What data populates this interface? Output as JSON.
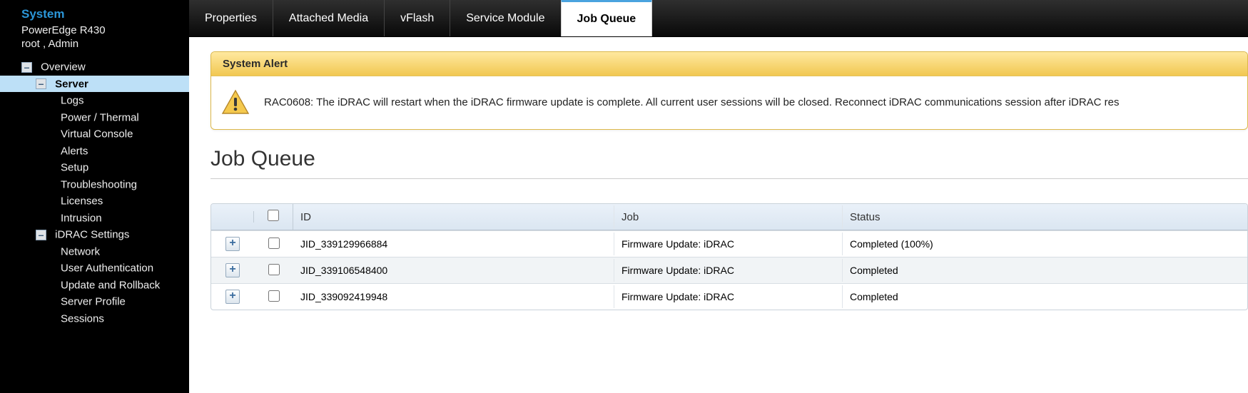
{
  "sidebar": {
    "system_label": "System",
    "model": "PowerEdge R430",
    "user": "root , Admin",
    "tree": {
      "overview": "Overview",
      "server": "Server",
      "server_children": [
        "Logs",
        "Power / Thermal",
        "Virtual Console",
        "Alerts",
        "Setup",
        "Troubleshooting",
        "Licenses",
        "Intrusion"
      ],
      "idrac": "iDRAC Settings",
      "idrac_children": [
        "Network",
        "User Authentication",
        "Update and Rollback",
        "Server Profile",
        "Sessions"
      ]
    }
  },
  "tabs": [
    "Properties",
    "Attached Media",
    "vFlash",
    "Service Module",
    "Job Queue"
  ],
  "active_tab": "Job Queue",
  "alert": {
    "title": "System Alert",
    "message": "RAC0608: The iDRAC will restart when the iDRAC firmware update is complete. All current user sessions will be closed. Reconnect iDRAC communications session after iDRAC res"
  },
  "page_title": "Job Queue",
  "table": {
    "headers": {
      "id": "ID",
      "job": "Job",
      "status": "Status"
    },
    "rows": [
      {
        "id": "JID_339129966884",
        "job": "Firmware Update: iDRAC",
        "status": "Completed (100%)"
      },
      {
        "id": "JID_339106548400",
        "job": "Firmware Update: iDRAC",
        "status": "Completed"
      },
      {
        "id": "JID_339092419948",
        "job": "Firmware Update: iDRAC",
        "status": "Completed"
      }
    ]
  }
}
